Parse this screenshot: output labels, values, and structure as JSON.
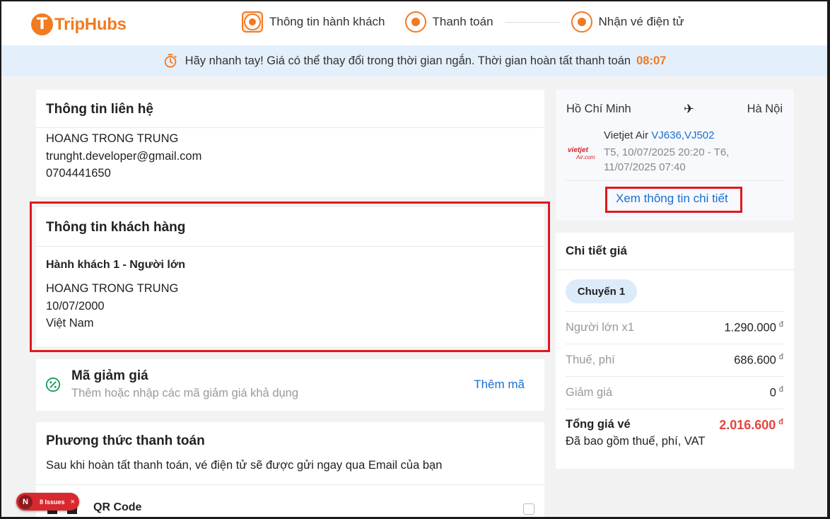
{
  "header": {
    "logo_mark": "T",
    "logo_text": "TripHubs",
    "steps": [
      {
        "label": "Thông tin hành khách"
      },
      {
        "label": "Thanh toán"
      },
      {
        "label": "Nhận vé điện tử"
      }
    ]
  },
  "banner": {
    "message": "Hãy nhanh tay! Giá có thể thay đổi trong thời gian ngắn. Thời gian hoàn tất thanh toán",
    "countdown": "08:07"
  },
  "contact": {
    "title": "Thông tin liên hệ",
    "name": "HOANG TRONG TRUNG",
    "email": "trunght.developer@gmail.com",
    "phone": "0704441650"
  },
  "customer": {
    "title": "Thông tin khách hàng",
    "passenger_label": "Hành khách 1 - Người lớn",
    "name": "HOANG TRONG TRUNG",
    "dob": "10/07/2000",
    "nationality": "Việt Nam"
  },
  "discount": {
    "title": "Mã giảm giá",
    "subtitle": "Thêm hoặc nhập các mã giảm giá khả dụng",
    "add_label": "Thêm mã"
  },
  "payment": {
    "title": "Phương thức thanh toán",
    "subtitle": "Sau khi hoàn tất thanh toán, vé điện tử sẽ được gửi ngay qua Email của bạn",
    "method_label": "QR Code"
  },
  "flight": {
    "from": "Hồ Chí Minh",
    "to": "Hà Nội",
    "airline_logo_text": "vietjet Air.com",
    "airline": "Vietjet Air",
    "codes": "VJ636,VJ502",
    "times": "T5, 10/07/2025 20:20 - T6, 11/07/2025 07:40",
    "detail_link": "Xem thông tin chi tiết"
  },
  "price": {
    "title": "Chi tiết giá",
    "chip": "Chuyến 1",
    "rows": [
      {
        "label": "Người lớn x1",
        "value": "1.290.000"
      },
      {
        "label": "Thuế, phí",
        "value": "686.600"
      },
      {
        "label": "Giảm giá",
        "value": "0"
      }
    ],
    "currency": "đ",
    "total_label": "Tổng giá vé",
    "total_value": "2.016.600",
    "total_note": "Đã bao gồm thuế, phí, VAT"
  },
  "dev_badge": {
    "letter": "N",
    "issues": "8 Issues",
    "close": "×"
  },
  "colors": {
    "brand": "#f27a21",
    "link": "#1a6fd1",
    "highlight": "#e0181f",
    "total": "#e0483d"
  }
}
